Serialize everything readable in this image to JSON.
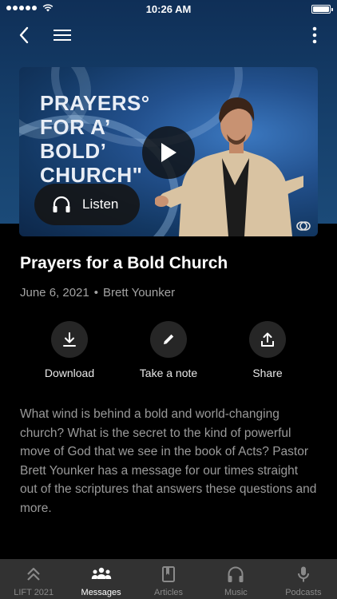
{
  "status_bar": {
    "time": "10:26 AM"
  },
  "media": {
    "slide_title": [
      "PRAYERS°",
      "FOR A’",
      "BOLD’",
      "CHURCH\""
    ],
    "listen_label": "Listen"
  },
  "sermon": {
    "title": "Prayers for a Bold Church",
    "date": "June 6, 2021",
    "separator": "•",
    "speaker": "Brett Younker",
    "description": "What wind is behind a bold and world-changing church? What is the secret to the kind of powerful move of God that we see in the book of Acts? Pastor Brett Younker has a message for our times straight out of the scriptures that answers these questions and more."
  },
  "actions": {
    "download": "Download",
    "note": "Take a note",
    "share": "Share"
  },
  "tabs": [
    {
      "label": "LIFT 2021",
      "icon": "double-chevron-up-icon",
      "active": false
    },
    {
      "label": "Messages",
      "icon": "people-icon",
      "active": true
    },
    {
      "label": "Articles",
      "icon": "book-icon",
      "active": false
    },
    {
      "label": "Music",
      "icon": "headphones-icon",
      "active": false
    },
    {
      "label": "Podcasts",
      "icon": "microphone-icon",
      "active": false
    }
  ],
  "colors": {
    "header_bg": "#16406c",
    "background": "#000000",
    "tab_bar_bg": "#323232",
    "action_circle": "#262626",
    "muted_text": "#9a9a9a"
  }
}
